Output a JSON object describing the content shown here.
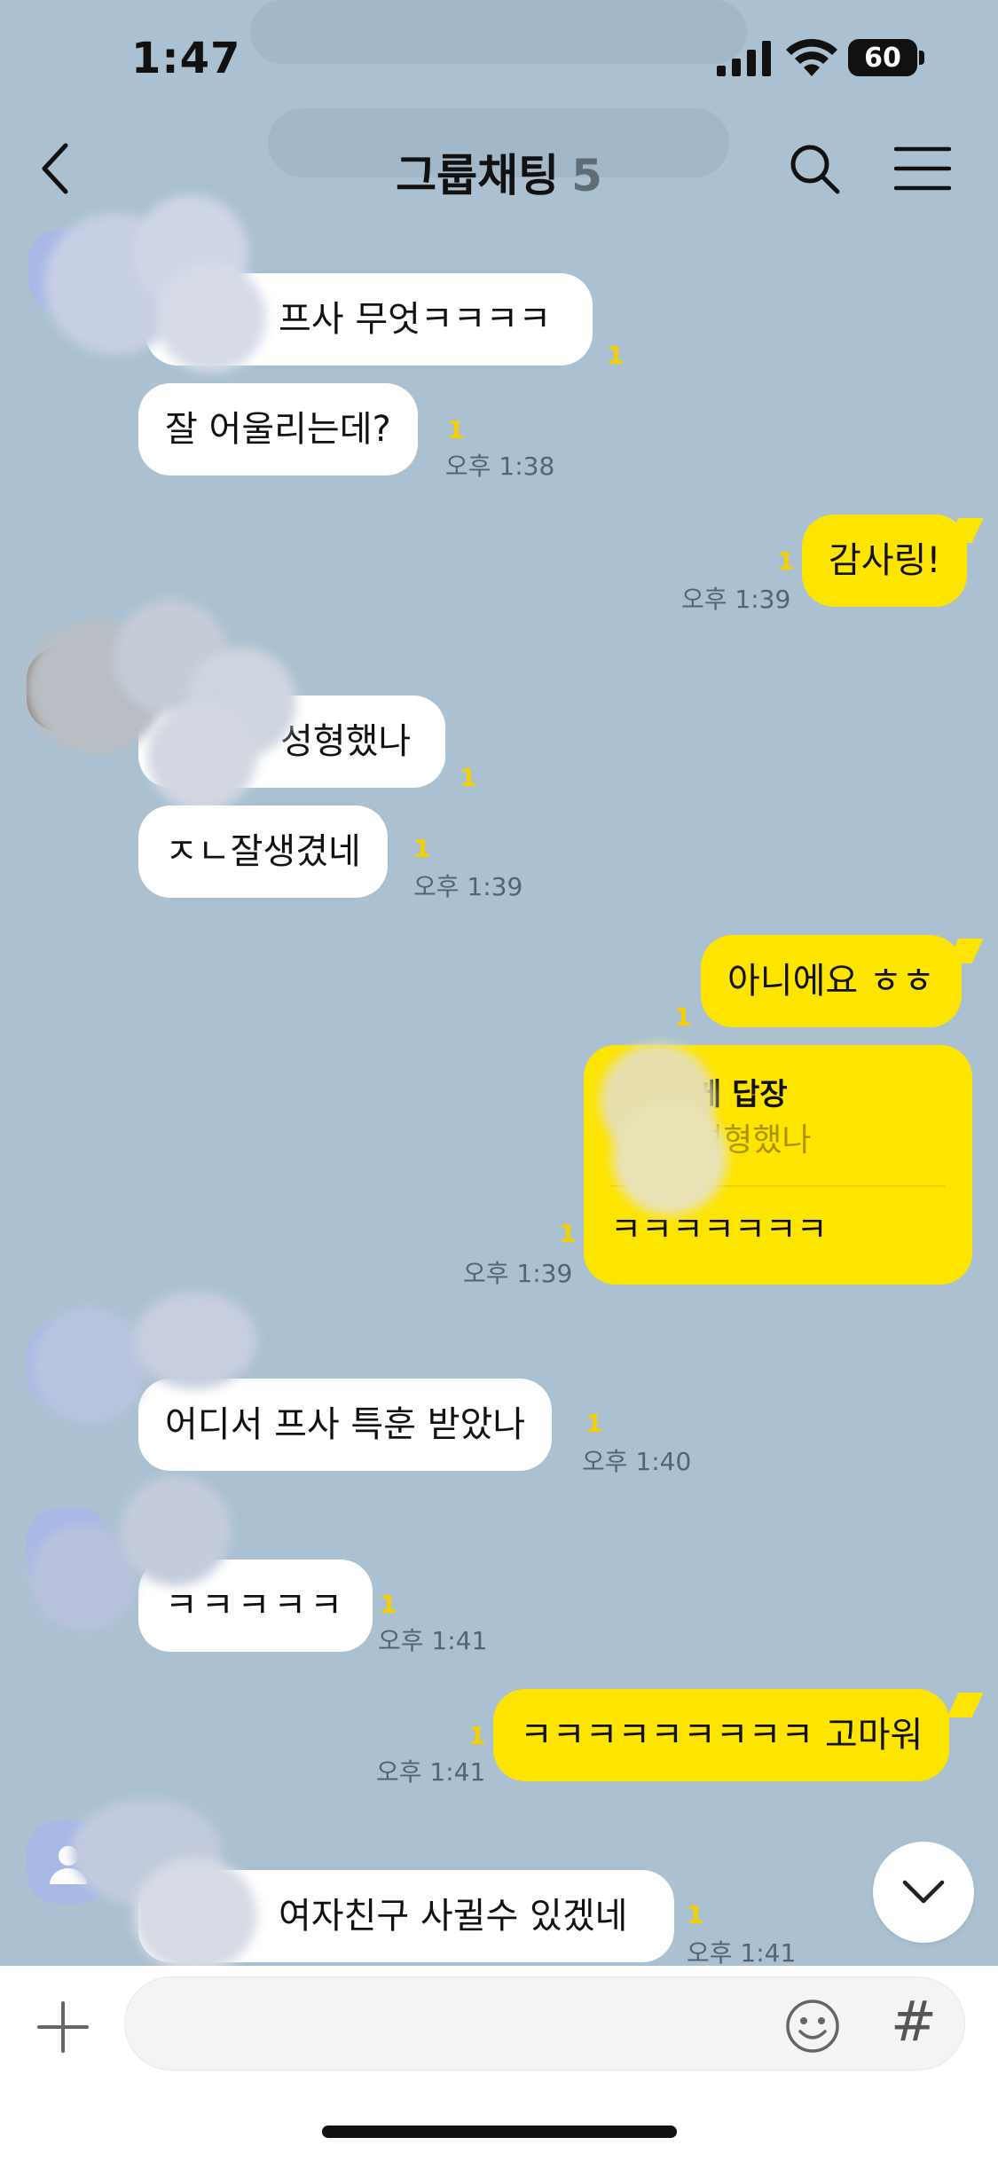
{
  "status": {
    "time": "1:47",
    "battery": "60"
  },
  "header": {
    "title": "그룹채팅",
    "count": "5"
  },
  "messages": [
    {
      "text": "프사 무엇ㅋㅋㅋㅋ",
      "unread": "1"
    },
    {
      "text": "잘 어울리는데?",
      "unread": "1",
      "time": "오후 1:38"
    },
    {
      "text": "감사링!",
      "unread": "1",
      "time": "오후 1:39"
    },
    {
      "text": "성형했나",
      "unread": "1"
    },
    {
      "text": "ㅈㄴ잘생겼네",
      "unread": "1",
      "time": "오후 1:39"
    },
    {
      "text": "아니에요 ㅎㅎ",
      "unread": "1"
    },
    {
      "reply_to": "게 답장",
      "reply_quote": "성형했나",
      "text": "ㅋㅋㅋㅋㅋㅋㅋ",
      "unread": "1",
      "time": "오후 1:39"
    },
    {
      "text": "어디서 프사 특훈 받았나",
      "unread": "1",
      "time": "오후 1:40"
    },
    {
      "text": "ㅋㅋㅋㅋㅋ",
      "unread": "1",
      "time": "오후 1:41"
    },
    {
      "text": "ㅋㅋㅋㅋㅋㅋㅋㅋㅋ 고마워",
      "unread": "1",
      "time": "오후 1:41"
    },
    {
      "text": "여자친구 사귈수 있겠네",
      "unread": "1",
      "time": "오후 1:41"
    }
  ],
  "input": {
    "placeholder": ""
  },
  "icons": [
    "back-icon",
    "search-icon",
    "menu-icon",
    "chevron-down-icon",
    "plus-icon",
    "emoji-icon",
    "hashtag-icon"
  ],
  "colors": {
    "background": "#abc1d1",
    "my_bubble": "#fee500",
    "unread": "#f3d000"
  }
}
